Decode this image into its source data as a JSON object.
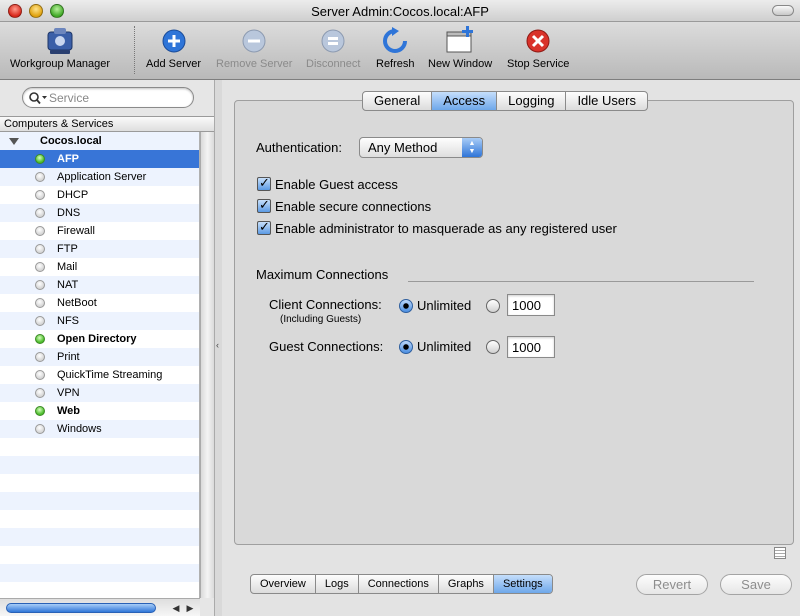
{
  "window": {
    "title": "Server Admin:Cocos.local:AFP"
  },
  "toolbar": {
    "items": [
      {
        "label": "Workgroup Manager",
        "icon": "workgroup-manager-icon",
        "enabled": true
      },
      {
        "label": "Add Server",
        "icon": "add-server-icon",
        "enabled": true
      },
      {
        "label": "Remove Server",
        "icon": "remove-server-icon",
        "enabled": false
      },
      {
        "label": "Disconnect",
        "icon": "disconnect-icon",
        "enabled": false
      },
      {
        "label": "Refresh",
        "icon": "refresh-icon",
        "enabled": true
      },
      {
        "label": "New Window",
        "icon": "new-window-icon",
        "enabled": true
      },
      {
        "label": "Stop Service",
        "icon": "stop-service-icon",
        "enabled": true
      }
    ]
  },
  "sidebar": {
    "search_placeholder": "Service",
    "header": "Computers & Services",
    "server": "Cocos.local",
    "services": [
      {
        "name": "AFP",
        "running": true,
        "selected": true
      },
      {
        "name": "Application Server",
        "running": false
      },
      {
        "name": "DHCP",
        "running": false
      },
      {
        "name": "DNS",
        "running": false
      },
      {
        "name": "Firewall",
        "running": false
      },
      {
        "name": "FTP",
        "running": false
      },
      {
        "name": "Mail",
        "running": false
      },
      {
        "name": "NAT",
        "running": false
      },
      {
        "name": "NetBoot",
        "running": false
      },
      {
        "name": "NFS",
        "running": false
      },
      {
        "name": "Open Directory",
        "running": true
      },
      {
        "name": "Print",
        "running": false
      },
      {
        "name": "QuickTime Streaming",
        "running": false
      },
      {
        "name": "VPN",
        "running": false
      },
      {
        "name": "Web",
        "running": true
      },
      {
        "name": "Windows",
        "running": false
      }
    ]
  },
  "tabs": [
    {
      "label": "General",
      "active": false
    },
    {
      "label": "Access",
      "active": true
    },
    {
      "label": "Logging",
      "active": false
    },
    {
      "label": "Idle Users",
      "active": false
    }
  ],
  "access": {
    "authentication_label": "Authentication:",
    "authentication_value": "Any Method",
    "checkboxes": [
      {
        "label": "Enable Guest access",
        "checked": true
      },
      {
        "label": "Enable secure connections",
        "checked": true
      },
      {
        "label": "Enable administrator to masquerade as any registered user",
        "checked": true
      }
    ],
    "max_connections_title": "Maximum Connections",
    "client": {
      "label": "Client Connections:",
      "sublabel": "(Including Guests)",
      "unlimited_label": "Unlimited",
      "value": "1000"
    },
    "guest": {
      "label": "Guest Connections:",
      "unlimited_label": "Unlimited",
      "value": "1000"
    }
  },
  "bottom_tabs": [
    {
      "label": "Overview",
      "active": false
    },
    {
      "label": "Logs",
      "active": false
    },
    {
      "label": "Connections",
      "active": false
    },
    {
      "label": "Graphs",
      "active": false
    },
    {
      "label": "Settings",
      "active": true
    }
  ],
  "buttons": {
    "revert": "Revert",
    "save": "Save"
  },
  "colors": {
    "selection": "#3875d7",
    "running_dot": "#4cbd2c",
    "stop_red": "#d9322a",
    "add_blue": "#2f75d8"
  }
}
